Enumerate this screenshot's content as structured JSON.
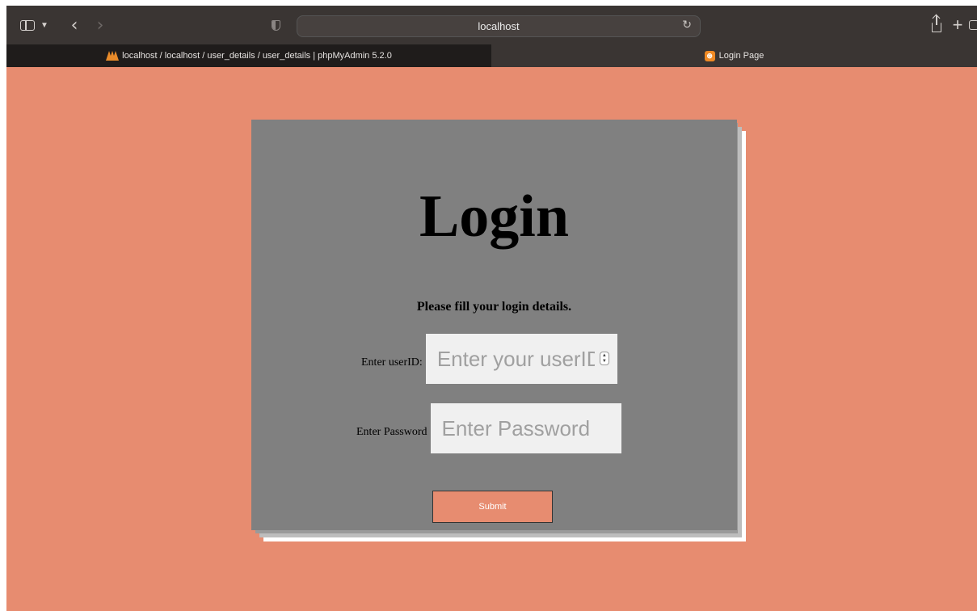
{
  "browser": {
    "address": "localhost",
    "tabs": [
      {
        "label": "localhost / localhost / user_details / user_details | phpMyAdmin 5.2.0",
        "active": false
      },
      {
        "label": "Login Page",
        "active": true
      }
    ],
    "icons": [
      "sidebar-icon",
      "chevron-down-icon",
      "back-icon",
      "forward-icon",
      "shield-icon",
      "reload-icon",
      "share-icon",
      "plus-icon",
      "tab-overview-icon"
    ]
  },
  "page": {
    "background": "#e78c70",
    "card_color": "#808080",
    "title": "Login",
    "subtitle": "Please fill your login details.",
    "user_label": "Enter userID:",
    "user_placeholder": "Enter your userID",
    "password_label": "Enter Password",
    "password_placeholder": "Enter Password",
    "submit_label": "Submit"
  }
}
